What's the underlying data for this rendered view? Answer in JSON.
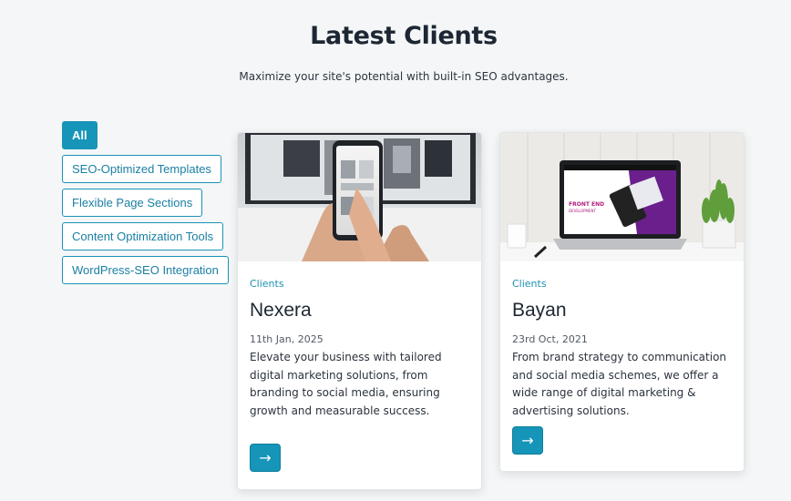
{
  "header": {
    "title": "Latest Clients",
    "subtitle": "Maximize your site's potential with built-in SEO advantages."
  },
  "filters": [
    {
      "label": "All",
      "active": true
    },
    {
      "label": "SEO-Optimized Templates",
      "active": false
    },
    {
      "label": "Flexible Page Sections",
      "active": false
    },
    {
      "label": "Content Optimization Tools",
      "active": false
    },
    {
      "label": "WordPress-SEO Integration",
      "active": false
    }
  ],
  "cards": [
    {
      "category": "Clients",
      "title": "Nexera",
      "date": "11th Jan, 2025",
      "text": "Elevate your business with tailored digital marketing solutions, from branding to social media, ensuring growth and measurable success.",
      "image_icon": "phone-in-hand-image"
    },
    {
      "category": "Clients",
      "title": "Bayan",
      "date": "23rd Oct, 2021",
      "text": "From brand strategy to communication and social media schemes, we offer a wide range of digital marketing & advertising solutions.",
      "image_icon": "laptop-front-end-development-image",
      "image_text_1": "FRONT END",
      "image_text_2": "DEVELOPMENT"
    }
  ],
  "colors": {
    "accent": "#1695b8",
    "background": "#f4f6f7"
  },
  "arrow_icon": "→"
}
